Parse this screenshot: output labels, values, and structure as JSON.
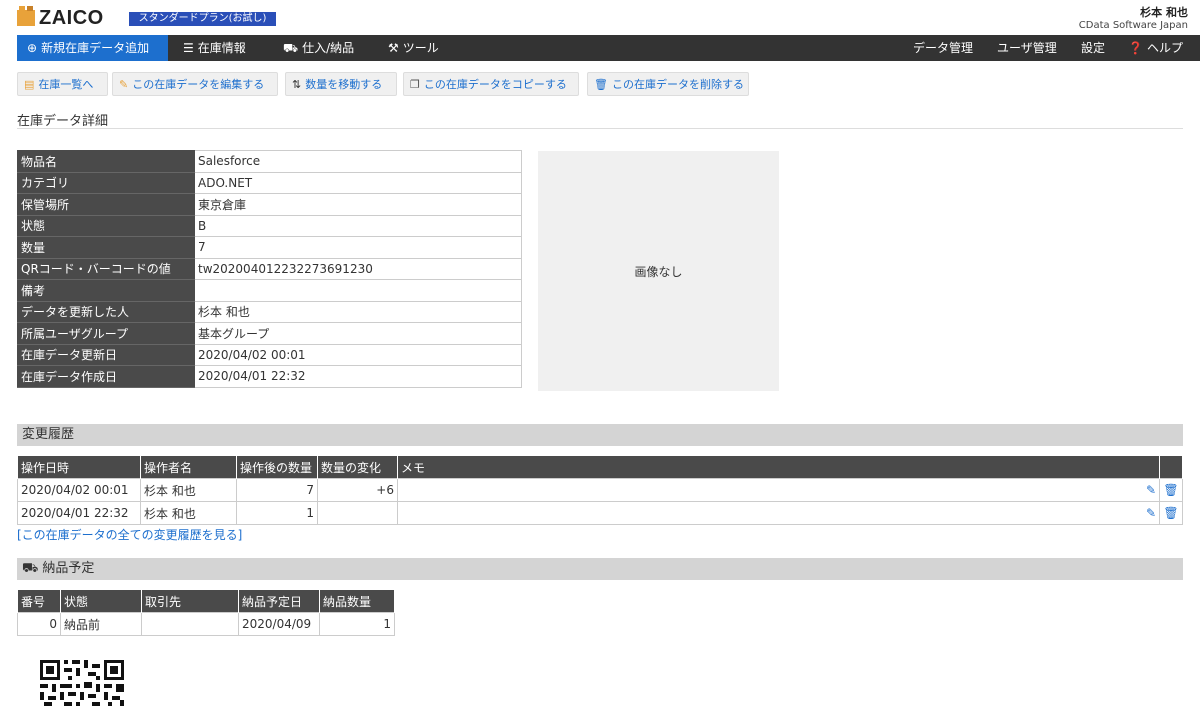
{
  "header": {
    "logo_text": "ZAICO",
    "plan_badge": "スタンダードプラン(お試し)",
    "user_name": "杉本 和也",
    "company": "CData Software Japan"
  },
  "nav": {
    "new_item": "新規在庫データ追加",
    "inventory": "在庫情報",
    "purchase": "仕入/納品",
    "tools": "ツール",
    "data_mgmt": "データ管理",
    "user_mgmt": "ユーザ管理",
    "settings": "設定",
    "help": "ヘルプ"
  },
  "toolbar": {
    "to_list": "在庫一覧へ",
    "edit": "この在庫データを編集する",
    "move_qty": "数量を移動する",
    "copy": "この在庫データをコピーする",
    "delete": "この在庫データを削除する"
  },
  "page_title": "在庫データ詳細",
  "details": [
    {
      "key": "物品名",
      "value": "Salesforce"
    },
    {
      "key": "カテゴリ",
      "value": "ADO.NET"
    },
    {
      "key": "保管場所",
      "value": "東京倉庫"
    },
    {
      "key": "状態",
      "value": "B"
    },
    {
      "key": "数量",
      "value": "7"
    },
    {
      "key": "QRコード・バーコードの値",
      "value": "tw202004012232273691230"
    },
    {
      "key": "備考",
      "value": ""
    },
    {
      "key": "データを更新した人",
      "value": "杉本 和也"
    },
    {
      "key": "所属ユーザグループ",
      "value": "基本グループ"
    },
    {
      "key": "在庫データ更新日",
      "value": "2020/04/02 00:01"
    },
    {
      "key": "在庫データ作成日",
      "value": "2020/04/01 22:32"
    }
  ],
  "image_placeholder": "画像なし",
  "history": {
    "title": "変更履歴",
    "headers": [
      "操作日時",
      "操作者名",
      "操作後の数量",
      "数量の変化",
      "メモ"
    ],
    "rows": [
      [
        "2020/04/02 00:01",
        "杉本 和也",
        "7",
        "+6",
        ""
      ],
      [
        "2020/04/01 22:32",
        "杉本 和也",
        "1",
        "",
        ""
      ]
    ],
    "all_link": "[この在庫データの全ての変更履歴を見る]"
  },
  "delivery": {
    "title": "納品予定",
    "headers": [
      "番号",
      "状態",
      "取引先",
      "納品予定日",
      "納品数量"
    ],
    "rows": [
      [
        "0",
        "納品前",
        "",
        "2020/04/09",
        "1"
      ]
    ]
  }
}
